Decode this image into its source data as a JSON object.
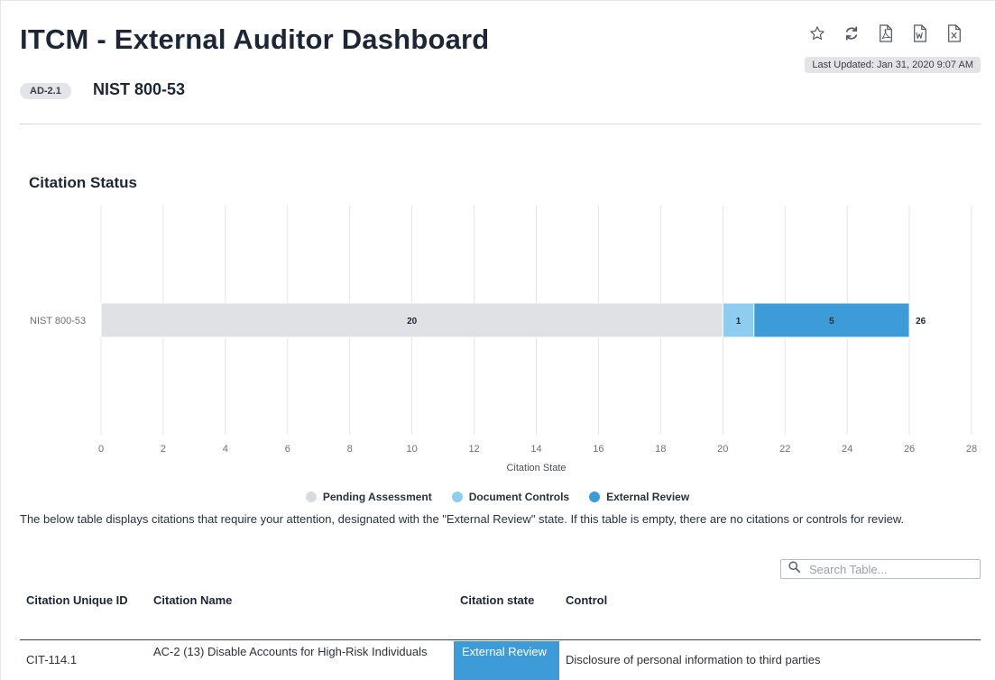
{
  "header": {
    "title": "ITCM - External Auditor Dashboard",
    "last_updated": "Last Updated: Jan 31, 2020 9:07 AM",
    "tag": "AD-2.1",
    "subtitle": "NIST 800-53",
    "toolbar_icons": [
      "star-icon",
      "refresh-icon",
      "pdf-icon",
      "word-icon",
      "excel-icon"
    ]
  },
  "section": {
    "title": "Citation Status"
  },
  "chart_data": {
    "type": "bar",
    "orientation": "horizontal",
    "stacked": true,
    "categories": [
      "NIST 800-53"
    ],
    "series": [
      {
        "name": "Pending Assessment",
        "values": [
          20
        ],
        "color": "#dfe1e4"
      },
      {
        "name": "Document Controls",
        "values": [
          1
        ],
        "color": "#8ecdf0"
      },
      {
        "name": "External Review",
        "values": [
          5
        ],
        "color": "#3d9cd8"
      }
    ],
    "totals": [
      26
    ],
    "xlabel": "Citation State",
    "xlim": [
      0,
      28
    ],
    "xticks": [
      0,
      2,
      4,
      6,
      8,
      10,
      12,
      14,
      16,
      18,
      20,
      22,
      24,
      26,
      28
    ],
    "grid": true,
    "legend_position": "bottom"
  },
  "description": "The below table displays citations that require your attention, designated with the \"External Review\" state. If this table is empty, there are no citations or controls for review.",
  "search": {
    "placeholder": "Search Table..."
  },
  "table": {
    "columns": [
      "Citation Unique ID",
      "Citation Name",
      "Citation state",
      "Control"
    ],
    "rows": [
      {
        "id": "CIT-114.1",
        "name": "AC-2 (13) Disable Accounts for High-Risk Individuals",
        "state": "External Review",
        "control": "Disclosure of personal information to third parties"
      }
    ]
  }
}
